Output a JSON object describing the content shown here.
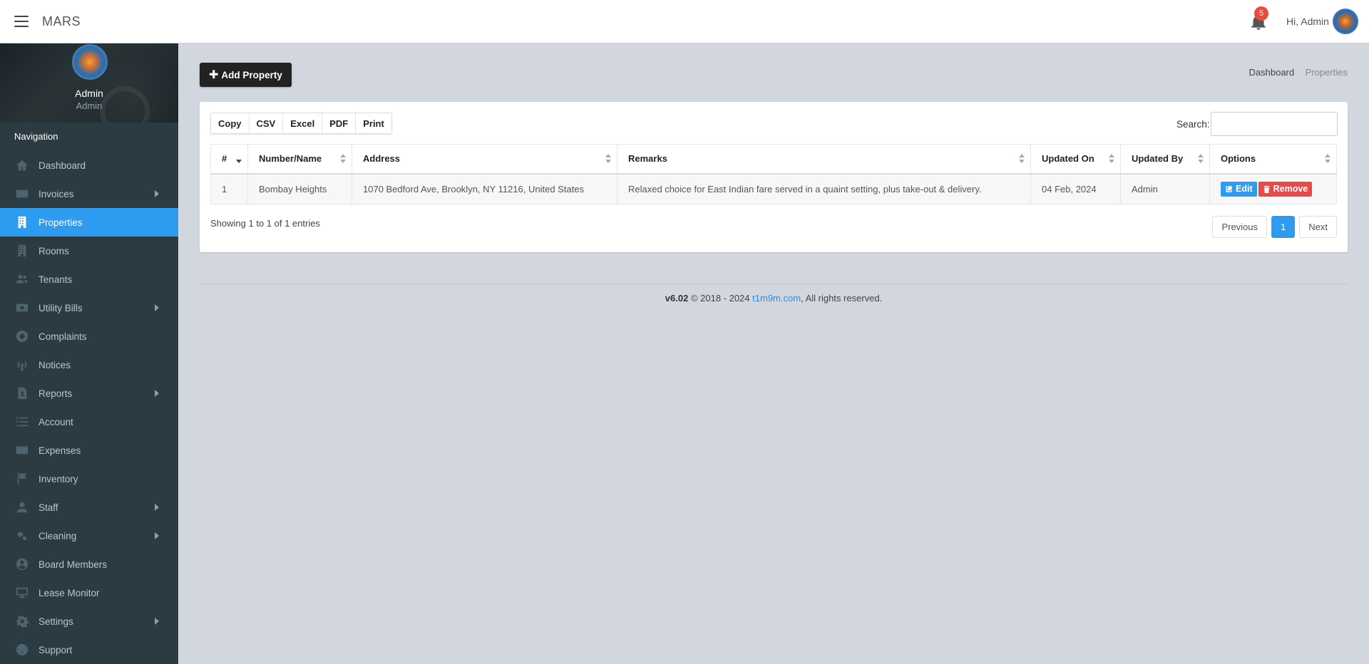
{
  "app": {
    "brand": "MARS"
  },
  "topbar": {
    "notification_count": "5",
    "greeting": "Hi, Admin"
  },
  "sidebar": {
    "user_name": "Admin",
    "user_role": "Admin",
    "nav_header": "Navigation",
    "items": [
      {
        "label": "Dashboard",
        "icon": "home-icon",
        "submenu": false,
        "active": false
      },
      {
        "label": "Invoices",
        "icon": "credit-card-icon",
        "submenu": true,
        "active": false
      },
      {
        "label": "Properties",
        "icon": "building-icon",
        "submenu": false,
        "active": true
      },
      {
        "label": "Rooms",
        "icon": "building-icon",
        "submenu": false,
        "active": false
      },
      {
        "label": "Tenants",
        "icon": "users-icon",
        "submenu": false,
        "active": false
      },
      {
        "label": "Utility Bills",
        "icon": "money-bill-icon",
        "submenu": true,
        "active": false
      },
      {
        "label": "Complaints",
        "icon": "life-ring-icon",
        "submenu": false,
        "active": false
      },
      {
        "label": "Notices",
        "icon": "broadcast-icon",
        "submenu": false,
        "active": false
      },
      {
        "label": "Reports",
        "icon": "excel-file-icon",
        "submenu": true,
        "active": false
      },
      {
        "label": "Account",
        "icon": "list-icon",
        "submenu": false,
        "active": false
      },
      {
        "label": "Expenses",
        "icon": "credit-card-icon",
        "submenu": false,
        "active": false
      },
      {
        "label": "Inventory",
        "icon": "flag-icon",
        "submenu": false,
        "active": false
      },
      {
        "label": "Staff",
        "icon": "user-icon",
        "submenu": true,
        "active": false
      },
      {
        "label": "Cleaning",
        "icon": "cogs-icon",
        "submenu": true,
        "active": false
      },
      {
        "label": "Board Members",
        "icon": "user-circle-icon",
        "submenu": false,
        "active": false
      },
      {
        "label": "Lease Monitor",
        "icon": "desktop-icon",
        "submenu": false,
        "active": false
      },
      {
        "label": "Settings",
        "icon": "gear-icon",
        "submenu": true,
        "active": false
      },
      {
        "label": "Support",
        "icon": "question-circle-icon",
        "submenu": false,
        "active": false
      }
    ]
  },
  "content": {
    "add_button_label": "Add Property",
    "breadcrumb": {
      "home": "Dashboard",
      "current": "Properties"
    },
    "export_buttons": [
      "Copy",
      "CSV",
      "Excel",
      "PDF",
      "Print"
    ],
    "search_label": "Search:",
    "search_value": "",
    "table": {
      "columns": [
        "#",
        "Number/Name",
        "Address",
        "Remarks",
        "Updated On",
        "Updated By",
        "Options"
      ],
      "rows": [
        {
          "num": "1",
          "name": "Bombay Heights",
          "address": "1070 Bedford Ave, Brooklyn, NY 11216, United States",
          "remarks": "Relaxed choice for East Indian fare served in a quaint setting, plus take-out & delivery.",
          "updated_on": "04 Feb, 2024",
          "updated_by": "Admin",
          "edit_label": "Edit",
          "remove_label": "Remove"
        }
      ]
    },
    "showing_text": "Showing 1 to 1 of 1 entries",
    "pager": {
      "previous": "Previous",
      "current": "1",
      "next": "Next"
    }
  },
  "footer": {
    "version": "v6.02",
    "copyright": "© 2018 - 2024",
    "link_text": "t1m9m.com",
    "rights": ", All rights reserved."
  },
  "colors": {
    "accent": "#2d9cf0",
    "sidebar_bg": "#2c3b41",
    "danger": "#e84a4a",
    "content_bg": "#d2d6de"
  }
}
